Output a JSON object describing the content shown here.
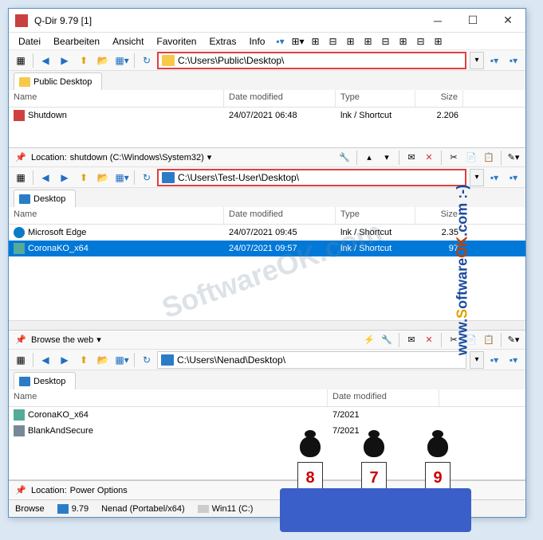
{
  "window": {
    "title": "Q-Dir 9.79 [1]"
  },
  "menu": {
    "datei": "Datei",
    "bearbeiten": "Bearbeiten",
    "ansicht": "Ansicht",
    "favoriten": "Favoriten",
    "extras": "Extras",
    "info": "Info"
  },
  "pane1": {
    "address": "C:\\Users\\Public\\Desktop\\",
    "tab": "Public Desktop",
    "cols": {
      "name": "Name",
      "date": "Date modified",
      "type": "Type",
      "size": "Size"
    },
    "rows": [
      {
        "name": "Shutdown",
        "date": "24/07/2021 06:48",
        "type": "lnk / Shortcut",
        "size": "2.206"
      }
    ]
  },
  "loc1": {
    "label": "Location:",
    "value": "shutdown (C:\\Windows\\System32)"
  },
  "pane2": {
    "address": "C:\\Users\\Test-User\\Desktop\\",
    "tab": "Desktop",
    "cols": {
      "name": "Name",
      "date": "Date modified",
      "type": "Type",
      "size": "Size"
    },
    "rows": [
      {
        "name": "Microsoft Edge",
        "date": "24/07/2021 09:45",
        "type": "lnk / Shortcut",
        "size": "2.35"
      },
      {
        "name": "CoronaKO_x64",
        "date": "24/07/2021 09:57",
        "type": "lnk / Shortcut",
        "size": "97",
        "selected": true
      }
    ]
  },
  "loc2": {
    "label": "Browse the web"
  },
  "pane3": {
    "address": "C:\\Users\\Nenad\\Desktop\\",
    "tab": "Desktop",
    "cols": {
      "name": "Name",
      "date": "Date modified"
    },
    "rows": [
      {
        "name": "CoronaKO_x64",
        "date": "7/2021"
      },
      {
        "name": "BlankAndSecure",
        "date": "7/2021"
      }
    ]
  },
  "loc3": {
    "label": "Location:",
    "value": "Power Options"
  },
  "status": {
    "browse": "Browse",
    "item1": "9.79",
    "item2": "Nenad (Portabel/x64)",
    "item3": "Win11 (C:)"
  },
  "watermark": "SoftwareOK.com",
  "sidebrand": {
    "prefix": "www.",
    "soft": "S",
    "oft": "oftware",
    "ok": "OK",
    "suffix": ".com :-)"
  },
  "judges": [
    "8",
    "7",
    "9"
  ]
}
